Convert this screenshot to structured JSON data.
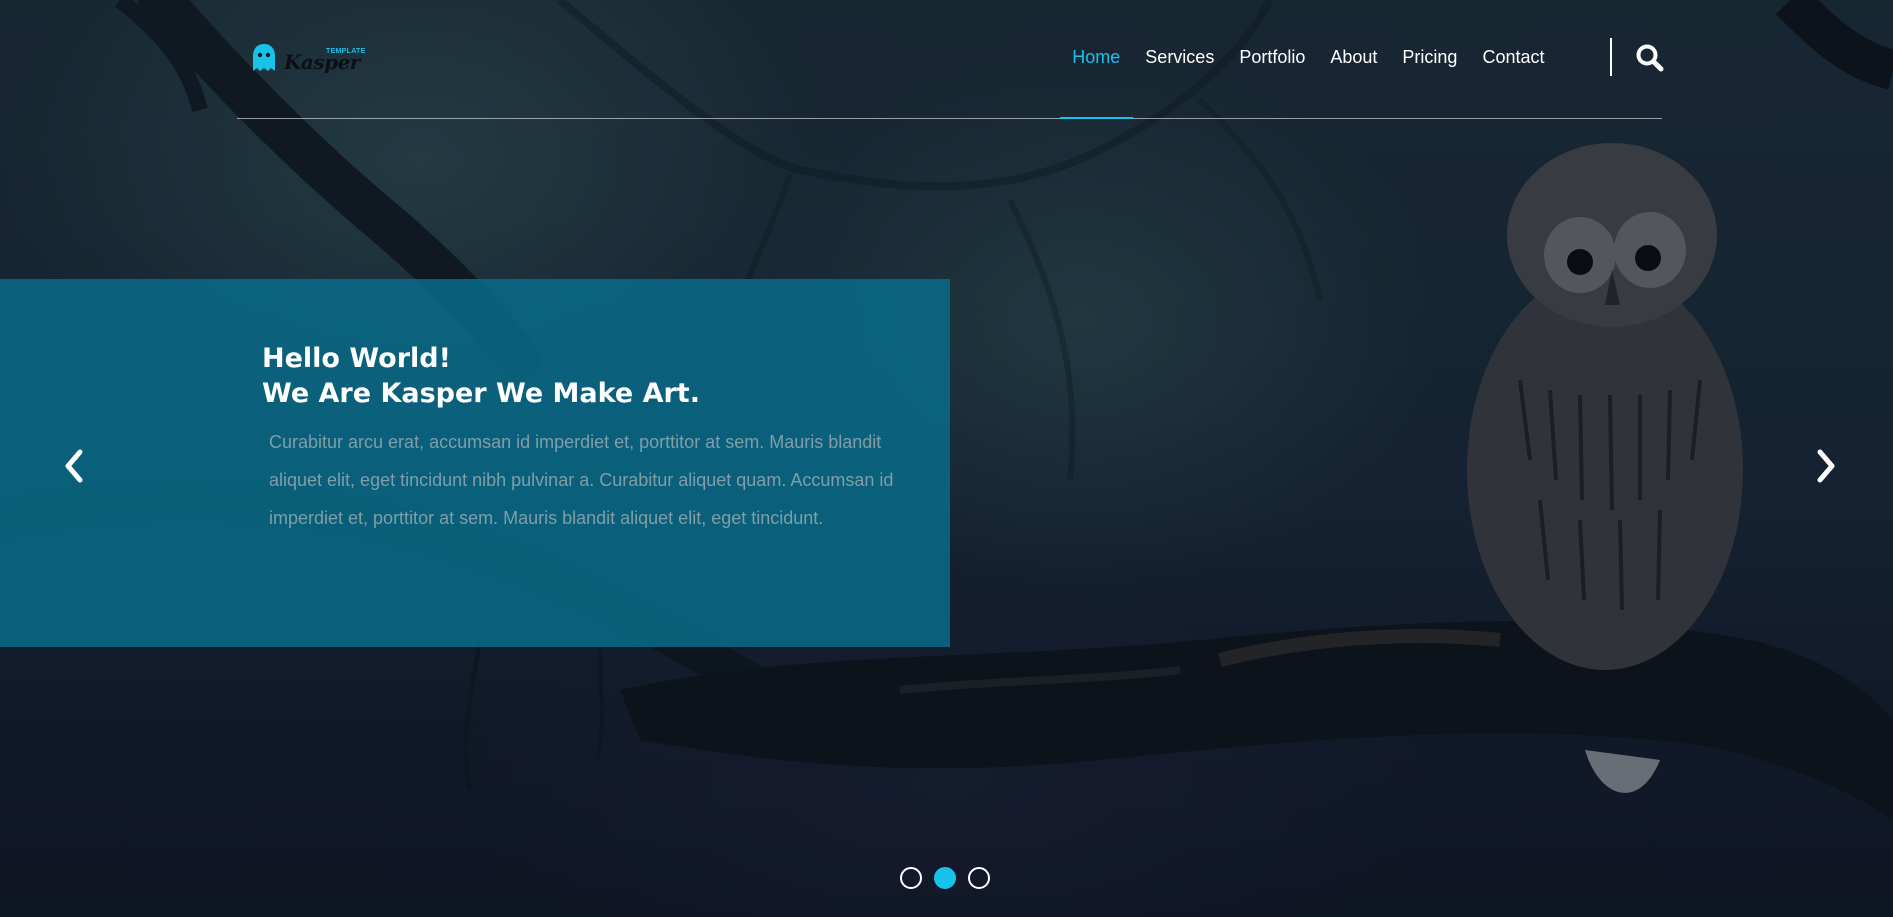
{
  "brand": {
    "logo_text": "Kasper",
    "logo_tag": "TEMPLATE",
    "accent": "#19c2ea"
  },
  "nav": {
    "items": [
      {
        "label": "Home",
        "active": true
      },
      {
        "label": "Services",
        "active": false
      },
      {
        "label": "Portfolio",
        "active": false
      },
      {
        "label": "About",
        "active": false
      },
      {
        "label": "Pricing",
        "active": false
      },
      {
        "label": "Contact",
        "active": false
      }
    ],
    "search_icon": "search-icon"
  },
  "hero": {
    "title_line1": "Hello World!",
    "title_line2": "We Are Kasper We Make Art.",
    "description": "Curabitur arcu erat, accumsan id imperdiet et, porttitor at sem. Mauris blandit aliquet elit, eget tincidunt nibh pulvinar a. Curabitur aliquet quam. Accumsan id imperdiet et, porttitor at sem. Mauris blandit aliquet elit, eget tincidunt.",
    "panel_color": "#096e8c",
    "prev_icon": "chevron-left-icon",
    "next_icon": "chevron-right-icon"
  },
  "slider": {
    "count": 3,
    "active_index": 1
  }
}
